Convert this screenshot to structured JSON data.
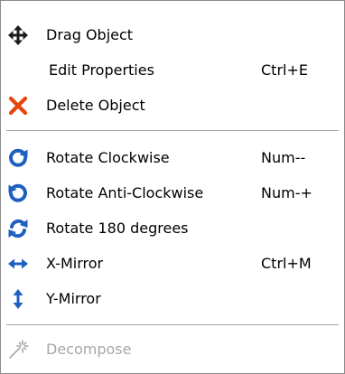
{
  "context_menu": {
    "items": [
      {
        "label": "Drag Object",
        "shortcut": "",
        "icon": "move-arrows-icon",
        "enabled": true
      },
      {
        "label": "Edit Properties",
        "shortcut": "Ctrl+E",
        "icon": "",
        "enabled": true
      },
      {
        "label": "Delete Object",
        "shortcut": "",
        "icon": "delete-x-icon",
        "enabled": true
      },
      {
        "label": "Rotate Clockwise",
        "shortcut": "Num--",
        "icon": "rotate-clockwise-icon",
        "enabled": true
      },
      {
        "label": "Rotate Anti-Clockwise",
        "shortcut": "Num-+",
        "icon": "rotate-anticlockwise-icon",
        "enabled": true
      },
      {
        "label": "Rotate 180 degrees",
        "shortcut": "",
        "icon": "rotate-180-icon",
        "enabled": true
      },
      {
        "label": "X-Mirror",
        "shortcut": "Ctrl+M",
        "icon": "horizontal-mirror-arrows-icon",
        "enabled": true
      },
      {
        "label": "Y-Mirror",
        "shortcut": "",
        "icon": "vertical-mirror-arrows-icon",
        "enabled": true
      },
      {
        "label": "Decompose",
        "shortcut": "",
        "icon": "decompose-wand-icon",
        "enabled": false
      }
    ],
    "colors": {
      "icon_blue": "#1f5fbf",
      "delete_red": "#e8440c",
      "disabled_text": "#a7a6aa",
      "separator": "#a6a6a6"
    }
  }
}
